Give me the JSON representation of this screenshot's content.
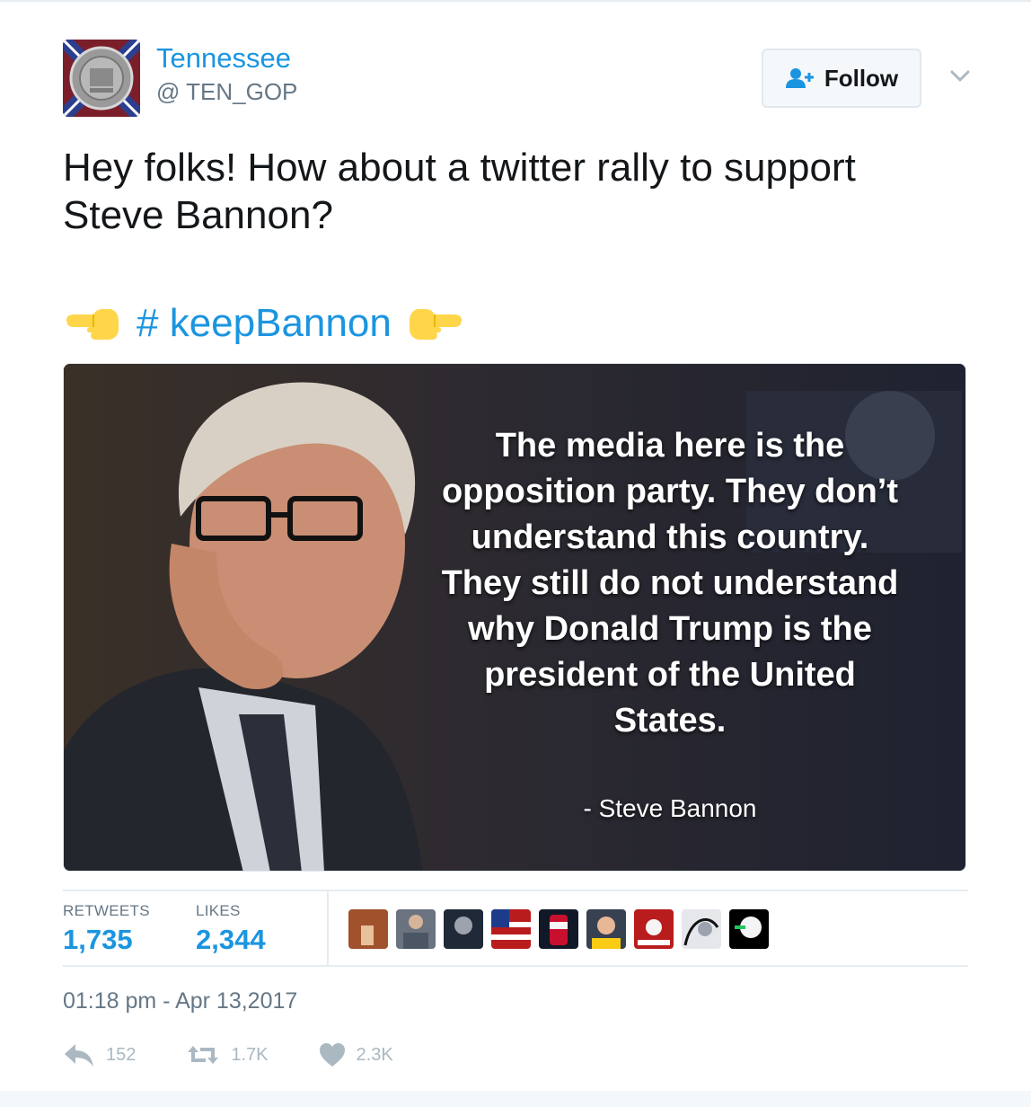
{
  "colors": {
    "link": "#1b95e0",
    "muted": "#657786",
    "action_icon": "#aab8c2"
  },
  "user": {
    "display_name": "Tennessee",
    "handle": "@ TEN_GOP",
    "avatar_icon": "state-seal-avatar"
  },
  "follow_button": {
    "label": "Follow",
    "icon": "add-user-icon"
  },
  "more_menu": {
    "icon": "chevron-down-icon"
  },
  "tweet": {
    "text": "Hey folks! How about a twitter rally to support Steve Bannon?",
    "hashtag": "# keepBannon",
    "hashtag_emoji_left": "backhand-index-pointing-left",
    "hashtag_emoji_right": "backhand-index-pointing-right"
  },
  "media": {
    "quote": "The media here is the opposition party. They don’t understand this country. They still do not understand why Donald Trump is the president of the United States.",
    "attribution": "- Steve Bannon"
  },
  "stats": {
    "retweets_label": "RETWEETS",
    "retweets_value": "1,735",
    "likes_label": "LIKES",
    "likes_value": "2,344",
    "liker_avatars": 9
  },
  "timestamp": "01:18 pm - Apr 13,2017",
  "actions": {
    "reply_count": "152",
    "retweet_count": "1.7K",
    "like_count": "2.3K"
  }
}
